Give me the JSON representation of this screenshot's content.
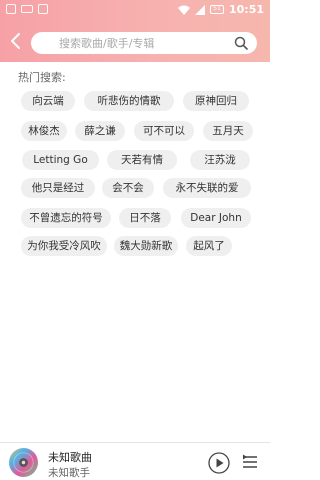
{
  "status_bar": {
    "time": "10:51",
    "battery": "51"
  },
  "search": {
    "placeholder": "搜索歌曲/歌手/专辑"
  },
  "hot_search": {
    "title": "热门搜索:",
    "tags": [
      "向云端",
      "听悲伤的情歌",
      "原神回归",
      "林俊杰",
      "薛之谦",
      "可不可以",
      "五月天",
      "Letting Go",
      "天若有情",
      "汪苏泷",
      "他只是经过",
      "会不会",
      "永不失联的爱",
      "不曾遗忘的符号",
      "日不落",
      "Dear John",
      "为你我受冷风吹",
      "魏大勋新歌",
      "起风了"
    ]
  },
  "player": {
    "title": "未知歌曲",
    "artist": "未知歌手"
  },
  "colors": {
    "header_start": "#f6a1a6",
    "header_end": "#f6b7ad",
    "tag_bg": "#efefef"
  }
}
